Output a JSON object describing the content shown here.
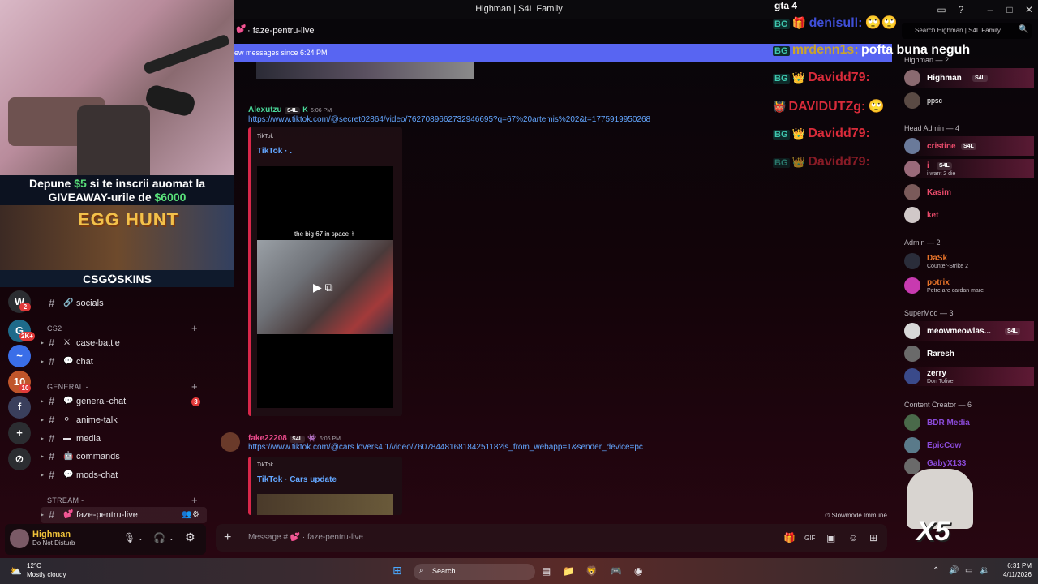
{
  "window": {
    "title": "Highman | S4L Family"
  },
  "webcam_overlay": {
    "promo_line1_pre": "Depune ",
    "promo_amount1": "$5",
    "promo_line1_post": " si te inscrii auomat la",
    "promo_line2_pre": "GIVEAWAY-urile de ",
    "promo_amount2": "$6000",
    "banner_title": "EGG HUNT",
    "brand": "CSG✪SKINS"
  },
  "server_rail": {
    "servers": [
      {
        "icon": "W",
        "badge": "2",
        "color": "#2b2d31"
      },
      {
        "icon": "G",
        "badge": "2K+",
        "color": "#1e6a8a"
      },
      {
        "icon": "~",
        "badge": "",
        "color": "#3a6ee8"
      },
      {
        "icon": "10",
        "badge": "10",
        "color": "#c0552a"
      },
      {
        "icon": "f",
        "badge": "",
        "color": "#3a3f5c"
      },
      {
        "icon": "+",
        "badge": "",
        "color": "#2b2d31"
      },
      {
        "icon": "⊘",
        "badge": "",
        "color": "#2b2d31"
      }
    ]
  },
  "channels": {
    "socials": "socials",
    "cat_cs2": "CS2",
    "case_battle": "case-battle",
    "chat": "chat",
    "cat_general": "GENERAL -",
    "general_chat": "general-chat",
    "general_chat_badge": "3",
    "anime_talk": "anime-talk",
    "media": "media",
    "commands": "commands",
    "mods_chat": "mods-chat",
    "cat_stream": "STREAM -",
    "faze_live": "faze-pentru-live"
  },
  "user_panel": {
    "name": "Highman",
    "status": "Do Not Disturb"
  },
  "chat": {
    "channel_name": "faze-pentru-live",
    "new_messages": "ew messages since 6:24 PM",
    "messages": [
      {
        "author": "Alexutzu",
        "tag": "S4L",
        "time": "6:06 PM",
        "link": "https://www.tiktok.com/@secret02864/video/7627089662732946695?q=67%20artemis%202&t=1775919950268",
        "embed_provider": "TikTok",
        "embed_title": "TikTok · .",
        "video_caption": "the big 67 in space ✌"
      },
      {
        "author": "fake22208",
        "tag": "S4L",
        "time": "6:06 PM",
        "link": "https://www.tiktok.com/@cars.lovers4.1/video/7607844816818425118?is_from_webapp=1&sender_device=pc",
        "embed_provider": "TikTok",
        "embed_title": "TikTok · Cars update"
      }
    ],
    "slowmode": "Slowmode Immune",
    "composer_placeholder": "Message # 💕 · faze-pentru-live"
  },
  "stream_overlay": {
    "top_partial": "gta 4",
    "lines": [
      {
        "user": "denisull:",
        "text": "",
        "color": "#3f4fd8"
      },
      {
        "user": "mrdenn1s:",
        "text": "pofta buna neguh",
        "color": "#c9a42a"
      },
      {
        "user": "Davidd79:",
        "text": "",
        "color": "#d92b3a"
      },
      {
        "user": "DAVIDUTZg:",
        "text": "",
        "color": "#d92b3a"
      },
      {
        "user": "Davidd79:",
        "text": "",
        "color": "#d92b3a"
      },
      {
        "user": "Davidd79:",
        "text": "",
        "color": "#d92b3a"
      }
    ]
  },
  "members": {
    "search_placeholder": "Search Highman | S4L Family",
    "groups": [
      {
        "role": "Highman — 2",
        "members": [
          {
            "name": "Highman",
            "sub": "",
            "tag": "S4L",
            "color": "#ffffff",
            "avatar": "#8a6a70"
          },
          {
            "name": "ppsc",
            "sub": "",
            "tag": "",
            "color": "#ffffff",
            "avatar": "#5a4a44"
          }
        ]
      },
      {
        "role": "Head Admin — 4",
        "members": [
          {
            "name": "cristine",
            "sub": "",
            "tag": "S4L",
            "color": "#e84a6a",
            "avatar": "#6a7a9a"
          },
          {
            "name": "i",
            "sub": "i want 2 die",
            "tag": "S4L",
            "color": "#e84a6a",
            "avatar": "#9a6a7a"
          },
          {
            "name": "Kasim",
            "sub": "",
            "tag": "",
            "color": "#e84a6a",
            "avatar": "#7a5a5a"
          },
          {
            "name": "ket",
            "sub": "",
            "tag": "",
            "color": "#e84a6a",
            "avatar": "#d0c8c8"
          }
        ]
      },
      {
        "role": "Admin — 2",
        "members": [
          {
            "name": "DaSk",
            "sub": "Counter-Strike 2",
            "tag": "",
            "color": "#e8742a",
            "avatar": "#2a2d3a"
          },
          {
            "name": "potrix",
            "sub": "Petre are cardan mare",
            "tag": "",
            "color": "#e8742a",
            "avatar": "#c83ab0"
          }
        ]
      },
      {
        "role": "SuperMod — 3",
        "members": [
          {
            "name": "meowmeowlas...",
            "sub": "",
            "tag": "S4L",
            "color": "#ffffff",
            "avatar": "#d8d8d8"
          },
          {
            "name": "Raresh",
            "sub": "",
            "tag": "",
            "color": "#ffffff",
            "avatar": "#6a6a6a"
          },
          {
            "name": "zerry",
            "sub": "Don Toliver",
            "tag": "",
            "color": "#ffffff",
            "avatar": "#3a4a8a"
          }
        ]
      },
      {
        "role": "Content Creator — 6",
        "members": [
          {
            "name": "BDR Media",
            "sub": "",
            "tag": "",
            "color": "#8a4ad8",
            "avatar": "#4a6a4a"
          },
          {
            "name": "EpicCow",
            "sub": "",
            "tag": "",
            "color": "#8a4ad8",
            "avatar": "#5a7a8a"
          },
          {
            "name": "GabyX133",
            "sub": "",
            "tag": "",
            "color": "#8a4ad8",
            "avatar": "#6a6a6a"
          }
        ]
      }
    ],
    "sticker_text": "X5"
  },
  "taskbar": {
    "temp": "12°C",
    "condition": "Mostly cloudy",
    "search": "Search",
    "time": "6:31 PM",
    "date": "4/11/2026"
  },
  "colors": {
    "accent": "#5865f2",
    "link": "#63a6ff",
    "embed_bar": "#d9274a"
  }
}
